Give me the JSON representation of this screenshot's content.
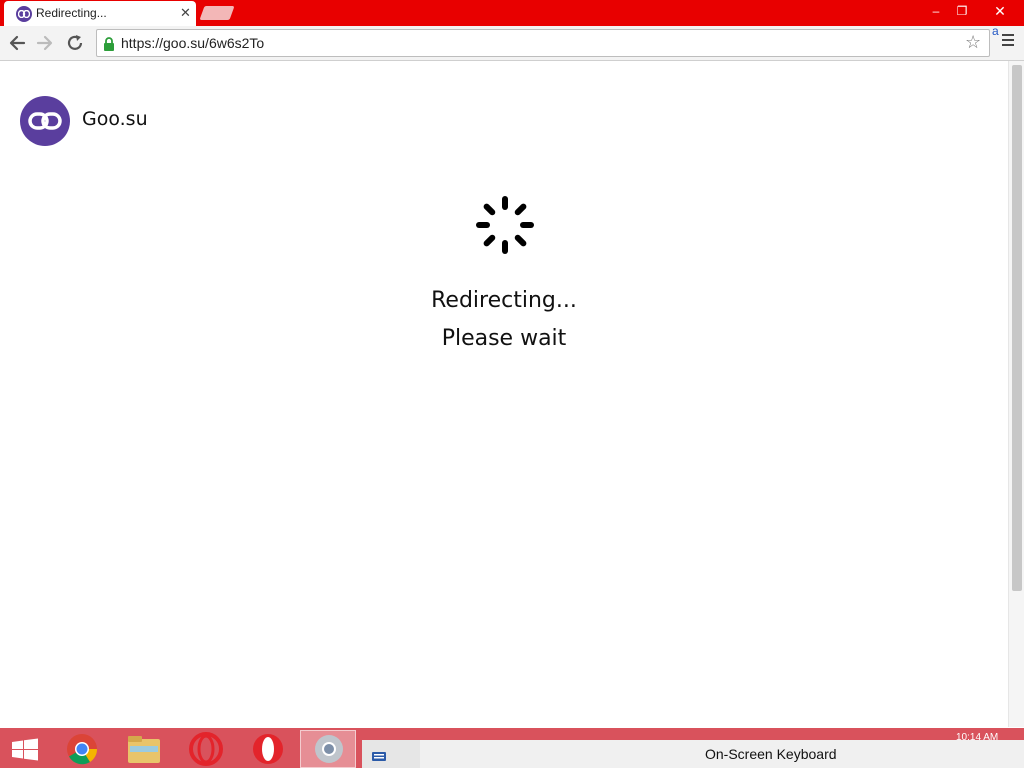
{
  "browser": {
    "tab_title": "Redirecting...",
    "tab_close": "✕",
    "url": "https://goo.su/6w6s2To",
    "window_min": "–",
    "window_max": "❐",
    "window_close": "✕",
    "amazon_badge": "a"
  },
  "page": {
    "brand_name": "Goo.su",
    "status_line1": "Redirecting...",
    "status_line2": "Please wait"
  },
  "taskbar": {
    "osk_label": "On-Screen Keyboard",
    "clock": "10:14 AM"
  },
  "colors": {
    "titlebar": "#e80000",
    "brand_purple": "#5a3e9e",
    "taskbar": "#d9525c"
  },
  "icons": [
    "back-icon",
    "forward-icon",
    "reload-icon",
    "lock-icon",
    "star-icon",
    "menu-icon",
    "chain-link-icon",
    "spinner-icon",
    "windows-start-icon",
    "chrome-icon",
    "file-explorer-icon",
    "opera-icon",
    "keyboard-icon"
  ]
}
